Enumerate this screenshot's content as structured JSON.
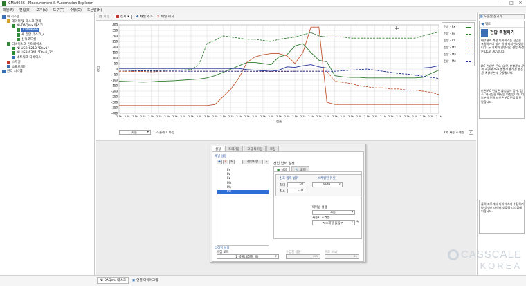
{
  "window": {
    "title": "CMA9666 - Measurement & Automation Explorer",
    "controls": [
      "–",
      "□",
      "✕"
    ]
  },
  "menu": [
    "파일(F)",
    "편집(E)",
    "보기(V)",
    "도구(T)",
    "수행(O)",
    "도움말(H)"
  ],
  "tree": [
    {
      "label": "내 시스템",
      "indent": 0,
      "icon": "computer-icon",
      "color": "#3a6fb5"
    },
    {
      "label": "데이터 및 태스크 관리",
      "indent": 1,
      "icon": "folder-icon",
      "color": "#d7a02b"
    },
    {
      "label": "NI-DAQmx 태스크",
      "indent": 2,
      "icon": "task-icon",
      "color": "#2f8a3a"
    },
    {
      "label": "CMA9666",
      "indent": 3,
      "icon": "task-icon",
      "color": "#2f8a3a",
      "selected": true
    },
    {
      "label": "새 전압 테스크_s",
      "indent": 3,
      "icon": "task-icon",
      "color": "#2f8a3a"
    },
    {
      "label": "신축로드셀",
      "indent": 3,
      "icon": "task-icon",
      "color": "#2f8a3a"
    },
    {
      "label": "디바이스와 인터페이스",
      "indent": 1,
      "icon": "device-icon",
      "color": "#2f8a3a"
    },
    {
      "label": "NI USB-6210 \"Dev1\"",
      "indent": 2,
      "icon": "usb-icon",
      "color": "#2f8a3a"
    },
    {
      "label": "NI USB-6341 \"Dev1_2\"",
      "indent": 2,
      "icon": "usb-icon",
      "color": "#2f8a3a"
    },
    {
      "label": "네트워크 디바이스",
      "indent": 2,
      "icon": "network-icon",
      "color": "#3a6fb5"
    },
    {
      "label": "스케일",
      "indent": 1,
      "icon": "scale-icon",
      "color": "#c0392b"
    },
    {
      "label": "소프트웨어",
      "indent": 1,
      "icon": "software-icon",
      "color": "#3a6fb5"
    },
    {
      "label": "원격 시스템",
      "indent": 0,
      "icon": "globe-icon",
      "color": "#3a6fb5"
    }
  ],
  "toolbar": {
    "run_label": "저장",
    "stop_label": "정지",
    "add_channel_label": "채널 추가",
    "remove_channel_label": "채널 제거"
  },
  "chart_data": {
    "type": "line",
    "title": "",
    "xlabel": "샘플",
    "ylabel": "전압",
    "ylim": [
      -400,
      400
    ],
    "yticks": [
      -400,
      -350,
      -300,
      -250,
      -200,
      -150,
      -100,
      -50,
      0,
      50,
      100,
      150,
      200,
      250,
      300,
      350,
      400
    ],
    "xtick_label": "2.1k",
    "xtick_count": 41,
    "grid": true,
    "legend_position": "top-right",
    "series": [
      {
        "name": "전압 - Fx",
        "color": "#2f7d2f",
        "dash": false,
        "values": [
          -110,
          -112,
          -115,
          -118,
          -115,
          -110,
          -108,
          -105,
          -100,
          -95,
          -90,
          -80,
          -60,
          -30,
          0,
          30,
          60,
          60,
          50,
          40,
          110,
          130,
          210,
          230,
          150,
          80,
          65,
          -60,
          -70,
          -75,
          -75,
          -80,
          -80,
          -80,
          -80,
          -80,
          -80,
          -80,
          -75,
          -40,
          -10
        ]
      },
      {
        "name": "전압 - Fy",
        "color": "#2f7d2f",
        "dash": true,
        "values": [
          -10,
          -12,
          -15,
          -18,
          -15,
          -12,
          -10,
          -10,
          -8,
          -5,
          40,
          230,
          260,
          300,
          290,
          280,
          270,
          270,
          260,
          250,
          270,
          280,
          290,
          310,
          330,
          300,
          290,
          290,
          290,
          280,
          280,
          280,
          280,
          280,
          280,
          280,
          280,
          280,
          300,
          320,
          335
        ]
      },
      {
        "name": "전압 - Fz",
        "color": "#c0532e",
        "dash": true,
        "values": [
          -20,
          -21,
          -22,
          -22,
          -25,
          -22,
          -20,
          -20,
          -20,
          -20,
          -20,
          -20,
          -20,
          -20,
          -20,
          -21,
          -21,
          -21,
          -22,
          -22,
          -22,
          -22,
          -20,
          -20,
          -20,
          -20,
          -20,
          -110,
          -120,
          -130,
          -150,
          -160,
          -170,
          -170,
          -180,
          -180,
          -190,
          -190,
          -200,
          -210,
          -230
        ]
      },
      {
        "name": "전압 - Mx",
        "color": "#c0532e",
        "dash": false,
        "values": [
          -330,
          -330,
          -330,
          -330,
          -330,
          -330,
          -330,
          -330,
          -330,
          -330,
          -330,
          -330,
          -320,
          -250,
          -180,
          -80,
          60,
          110,
          130,
          140,
          140,
          120,
          50,
          150,
          380,
          380,
          -300,
          -320,
          -320,
          -320,
          -320,
          -320,
          -320,
          -320,
          -320,
          -320,
          -320,
          -320,
          -320,
          -320,
          -320
        ]
      },
      {
        "name": "전압 - My",
        "color": "#1f2f96",
        "dash": false,
        "values": [
          5,
          5,
          5,
          5,
          5,
          5,
          5,
          5,
          5,
          5,
          5,
          5,
          5,
          5,
          5,
          5,
          -5,
          -10,
          -15,
          -20,
          -10,
          20,
          15,
          30,
          40,
          20,
          10,
          10,
          10,
          10,
          10,
          10,
          10,
          10,
          10,
          10,
          10,
          10,
          10,
          15,
          30
        ]
      },
      {
        "name": "전압 - Mz",
        "color": "#1f2f96",
        "dash": true,
        "values": [
          -10,
          -12,
          -15,
          -15,
          -18,
          -18,
          -18,
          -18,
          -20,
          -20,
          -20,
          -20,
          -20,
          -20,
          -20,
          -20,
          -20,
          -20,
          -20,
          -20,
          -20,
          -20,
          -20,
          -20,
          -20,
          -20,
          -20,
          -20,
          -15,
          -10,
          -5,
          0,
          -10,
          -20,
          -30,
          -40,
          -45,
          -55,
          -65,
          -75,
          -85
        ]
      }
    ]
  },
  "chart_controls": {
    "autoscale_select": "자동",
    "display_type_label": "디스플레이 타입",
    "y_autoscale_label": "Y축 자동 스케일",
    "y_autoscale_checked": "✓"
  },
  "dialog": {
    "tabs": [
      "설정",
      "트리거링",
      "고급 타이밍",
      "로깅"
    ],
    "channel_settings_label": "채널 설정",
    "details_button": "세부사항",
    "channels": [
      "Fx",
      "Fy",
      "Fz",
      "Mx",
      "My",
      "Mz"
    ],
    "selected_channel_index": 5,
    "voltage_input_title": "전압 입력 설정",
    "subtab_settings": "설정",
    "subtab_calibration": "교정",
    "signal_range_label": "신호 입력 범위",
    "max_label": "최대",
    "max_value": "10",
    "min_label": "최소",
    "min_value": "-10",
    "scaled_units_label": "스케일된 유닛",
    "units_value": "Volts",
    "terminal_config_label": "터미널 설정",
    "terminal_value": "차동",
    "custom_scale_label": "사용자 스케일",
    "custom_scale_value": "<스케일 없음>",
    "timing_label": "타이밍 설정",
    "acq_mode_label": "수집 모드",
    "acq_mode_value": "1 샘플(요청할 때)",
    "samples_label": "수집할 샘플",
    "samples_value": "100",
    "rate_label": "속도 (Hz)",
    "rate_value": "1k"
  },
  "right_pane": {
    "help_toggle": "도움말 숨기기",
    "back_label": "뒤로",
    "help_title": "전압 측정하기",
    "help_body_1": "대부분의 측정 디바이스는 전압을 측정하거나 읽기 위해 디자인되었습니다. 두 가지의 일반적인 전압 측정은 DC와 AC입니다.",
    "help_body_2": "DC 전압은 온도, 압력, 변형률과 같이 시간에 따라 천천히 변하는 현상을 측정하는데 유용합니다.",
    "help_body_3": "한편 AC 전압은 끊임없이 증가, 감소, 역극성을 바꾸는 파형입니다. 대부분의 전원 라인은 AC 전압을 전달합니다.",
    "bottom_help": "출력 포트에서 디바이스가 수집하거나 생성한 데이터 샘플을 디스플레이합니다."
  },
  "status_bar": {
    "tab_task": "NI-DAQmx 태스크",
    "tab_diagram": "연결 다이어그램"
  },
  "watermark": {
    "line1": "CASSCALE",
    "line2": "KOREA"
  }
}
